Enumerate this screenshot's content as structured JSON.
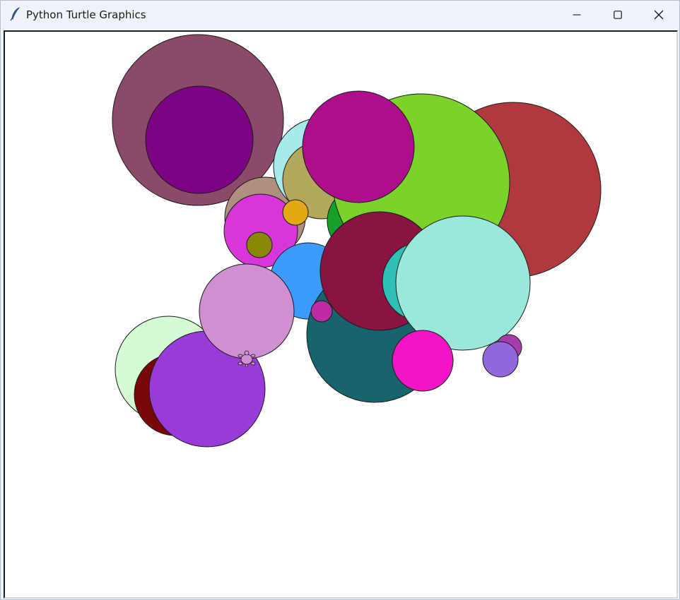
{
  "window": {
    "title": "Python Turtle Graphics",
    "app_icon": "feather-icon",
    "controls": {
      "minimize": "minimize-icon",
      "maximize": "maximize-icon",
      "close": "close-icon"
    }
  },
  "canvas": {
    "background": "#ffffff",
    "outline_color": "#1a1a1a",
    "circles": [
      {
        "color": "#8b4a67"
      },
      {
        "color": "#7d0385"
      },
      {
        "color": "#b08f80"
      },
      {
        "color": "#a6eaec"
      },
      {
        "color": "#b3a85b"
      },
      {
        "color": "#169f2a"
      },
      {
        "color": "#b0393f"
      },
      {
        "color": "#7bd22b"
      },
      {
        "color": "#ad0e8c"
      },
      {
        "color": "#d836da"
      },
      {
        "color": "#e2a912"
      },
      {
        "color": "#8b8709"
      },
      {
        "color": "#3a9bfd"
      },
      {
        "color": "#17646c"
      },
      {
        "color": "#891442"
      },
      {
        "color": "#31c0b7"
      },
      {
        "color": "#9ae8d9"
      },
      {
        "color": "#be2aa1"
      },
      {
        "color": "#d5fbd2"
      },
      {
        "color": "#790707"
      },
      {
        "color": "#993bd9"
      },
      {
        "color": "#cf90d2"
      },
      {
        "color": "#f214c5"
      },
      {
        "color": "#a63cad"
      },
      {
        "color": "#9266dc"
      }
    ],
    "turtle": {
      "shape": "turtle",
      "color": "#cf90d2"
    }
  }
}
